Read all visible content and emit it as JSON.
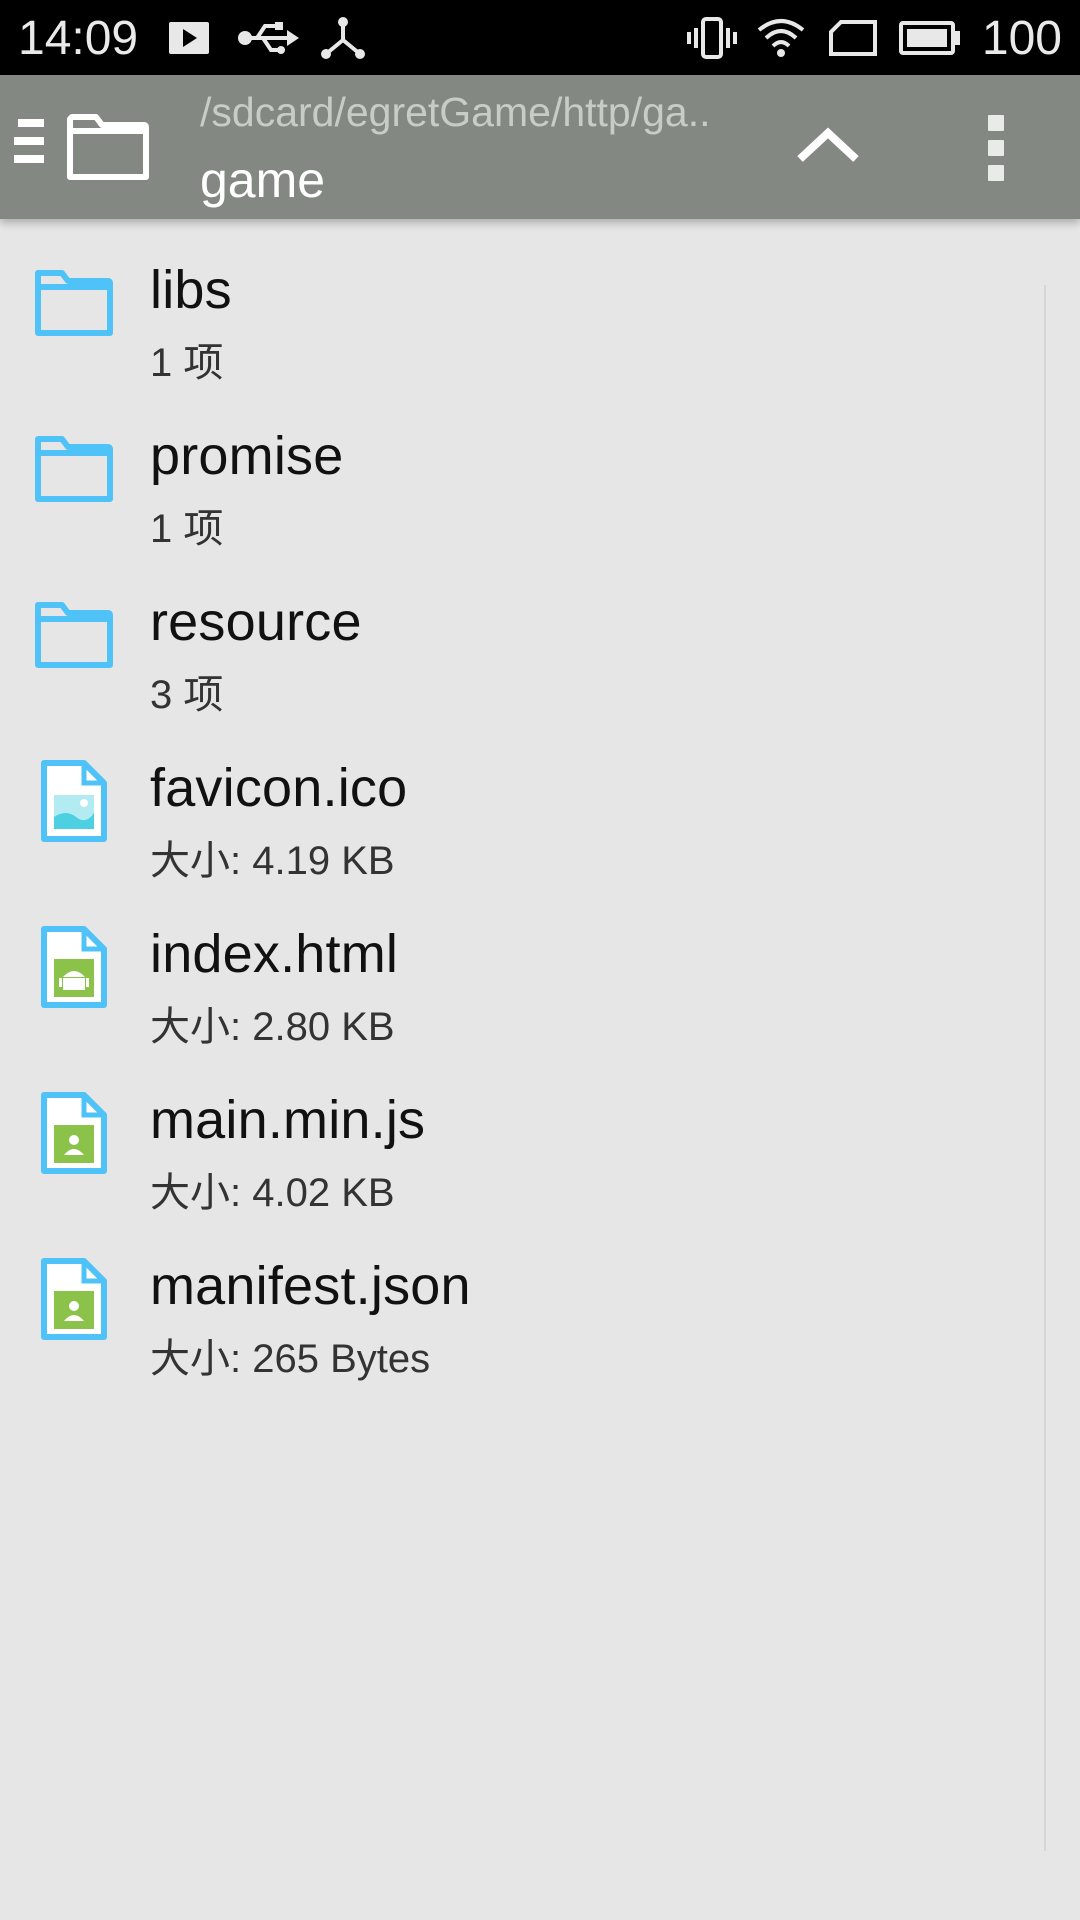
{
  "status_bar": {
    "time": "14:09",
    "battery_level": "100",
    "icons": [
      "play-notification-icon",
      "usb-icon",
      "debug-connection-icon",
      "vibrate-icon",
      "wifi-icon",
      "sim-card-icon",
      "battery-icon"
    ]
  },
  "toolbar": {
    "path": "/sdcard/egretGame/http/ga..",
    "title": "game",
    "icons": [
      "drawer-icon",
      "folder-icon",
      "up-arrow-icon",
      "overflow-menu-icon"
    ]
  },
  "colors": {
    "toolbar_bg": "#838982",
    "list_bg": "#e6e6e6",
    "folder_blue": "#4fc3f7",
    "file_green": "#8bc34a"
  },
  "files": [
    {
      "name": "libs",
      "meta": "1 项",
      "icon": "folder-icon"
    },
    {
      "name": "promise",
      "meta": "1 项",
      "icon": "folder-icon"
    },
    {
      "name": "resource",
      "meta": "3 项",
      "icon": "folder-icon"
    },
    {
      "name": "favicon.ico",
      "meta": "大小: 4.19 KB",
      "icon": "image-file-icon"
    },
    {
      "name": "index.html",
      "meta": "大小: 2.80 KB",
      "icon": "android-file-icon"
    },
    {
      "name": "main.min.js",
      "meta": "大小: 4.02 KB",
      "icon": "contact-file-icon"
    },
    {
      "name": "manifest.json",
      "meta": "大小: 265 Bytes",
      "icon": "contact-file-icon"
    }
  ]
}
